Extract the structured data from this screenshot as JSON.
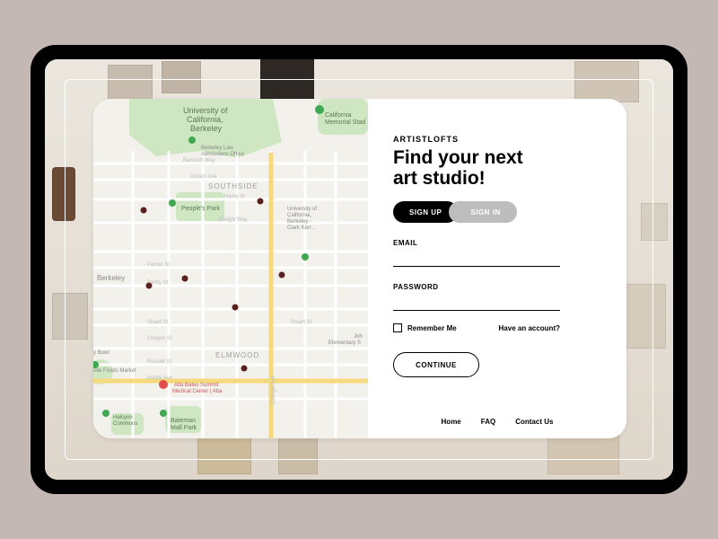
{
  "brand": "ARTISTLOFTS",
  "headline_line1": "Find your next",
  "headline_line2": "art studio!",
  "tabs": {
    "signup": "SIGN UP",
    "signin": "SIGN IN"
  },
  "fields": {
    "email_label": "EMAIL",
    "password_label": "PASSWORD",
    "email_value": "",
    "password_value": ""
  },
  "remember": {
    "label": "Remember Me",
    "checked": false
  },
  "have_account": "Have an account?",
  "continue_label": "CONTINUE",
  "footer": {
    "home": "Home",
    "faq": "FAQ",
    "contact": "Contact Us"
  },
  "map": {
    "labels": {
      "uc_berkeley_line1": "University of",
      "uc_berkeley_line2": "California,",
      "uc_berkeley_line3": "Berkeley",
      "cal_mem_stadium_line1": "California",
      "cal_mem_stadium_line2": "Memorial Stad",
      "admissions_line1": "Berkeley Law",
      "admissions_line2": "Admissions Office",
      "southside": "SOUTHSIDE",
      "peoples_park": "People's Park",
      "clark_kerr_line1": "University of",
      "clark_kerr_line2": "California,",
      "clark_kerr_line3": "Berkeley -",
      "clark_kerr_line4": "Clark Kerr...",
      "berkeley": "Berkeley",
      "elmwood": "ELMWOOD",
      "alta_bates_line1": "Alta Bates Summit",
      "alta_bates_line2": "Medical Center | Alta",
      "bateman_line1": "Bateman",
      "bateman_line2": "Mall Park",
      "halcyon_line1": "Halcyon",
      "halcyon_line2": "Commons",
      "whole_foods": "hole Foods Market",
      "john_elem_line1": "Joh",
      "john_elem_line2": "Elementary S",
      "y_bowl": "y Bowl",
      "haste": "Haste St",
      "dwight": "Dwight Way",
      "durant": "Durant Ave",
      "bancroft": "Bancroft Way",
      "parker": "Parker St",
      "derby": "Derby St",
      "stuart": "Stuart St",
      "stuart2": "Stuart St",
      "oregon": "Oregon St",
      "russell": "Russell St",
      "ashby": "Ashby Ave",
      "college": "College Ave"
    }
  }
}
